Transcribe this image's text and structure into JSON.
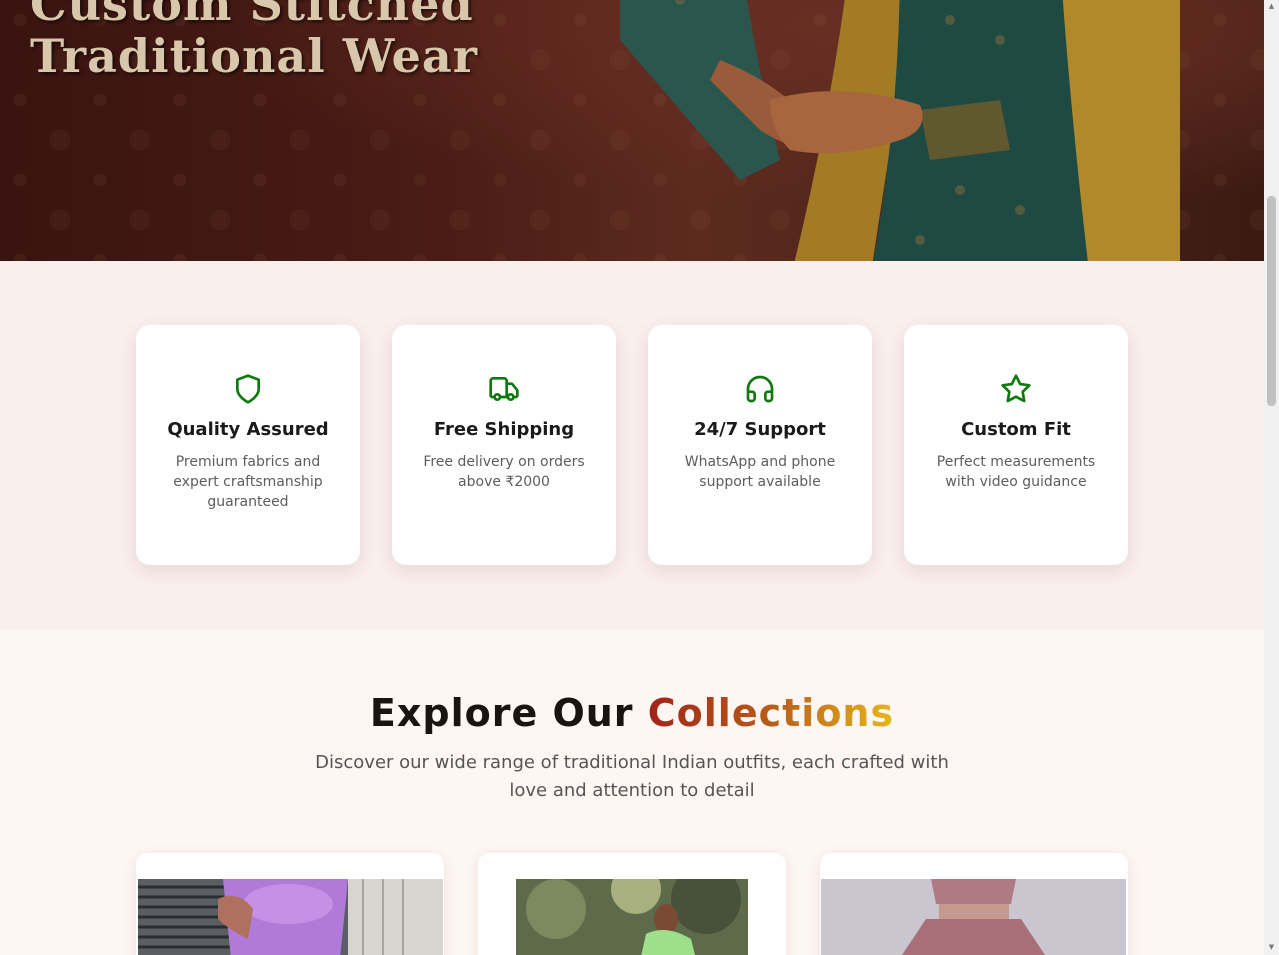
{
  "hero": {
    "title_line1": "Custom Stitched",
    "title_line2": "Traditional Wear"
  },
  "features": [
    {
      "icon": "shield-icon",
      "title": "Quality Assured",
      "description": "Premium fabrics and expert craftsmanship guaranteed"
    },
    {
      "icon": "truck-icon",
      "title": "Free Shipping",
      "description": "Free delivery on orders above ₹2000"
    },
    {
      "icon": "headphones-icon",
      "title": "24/7 Support",
      "description": "WhatsApp and phone support available"
    },
    {
      "icon": "star-icon",
      "title": "Custom Fit",
      "description": "Perfect measurements with video guidance"
    }
  ],
  "collections": {
    "title_plain": "Explore Our ",
    "title_accent": "Collections",
    "subtitle": "Discover our wide range of traditional Indian outfits, each crafted with love and attention to detail"
  },
  "colors": {
    "icon_green": "#0e7a0d",
    "accent_start": "#a0241a",
    "accent_end": "#e6b81a",
    "hero_bg": "#4a1c15",
    "features_bg": "#f9efec",
    "page_bg": "#fdf6f3"
  }
}
